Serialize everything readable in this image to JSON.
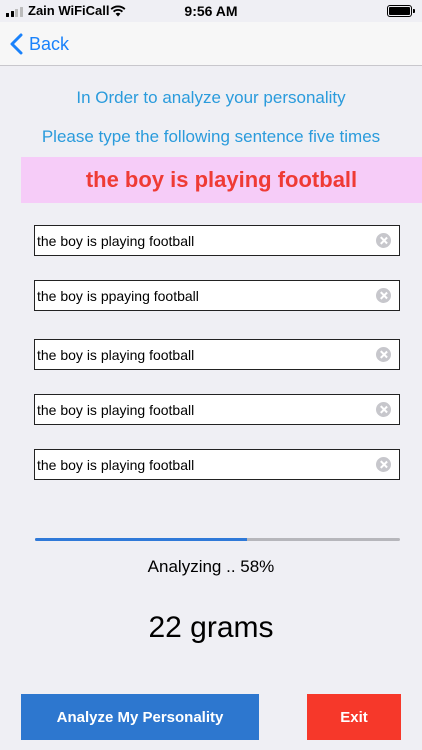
{
  "status_bar": {
    "carrier": "Zain WiFiCall",
    "time": "9:56 AM"
  },
  "nav": {
    "back_label": "Back"
  },
  "header": {
    "line1": "In Order to analyze your personality",
    "line2": "Please type the following sentence five times"
  },
  "target_sentence": "the boy is playing football",
  "inputs": [
    "the boy is playing football",
    "the boy is ppaying football",
    "the boy is playing football",
    "the boy is playing football",
    "the boy is playing football"
  ],
  "progress": {
    "fraction": 0.58,
    "status_text": "Analyzing .. 58%"
  },
  "result": "22 grams",
  "buttons": {
    "analyze_label": "Analyze My Personality",
    "exit_label": "Exit"
  },
  "colors": {
    "accent_blue": "#2d77cf",
    "headline_blue": "#2a9bdc",
    "target_red": "#ef3b35",
    "target_bg": "#f6ccf8",
    "exit_red": "#f6382a"
  }
}
